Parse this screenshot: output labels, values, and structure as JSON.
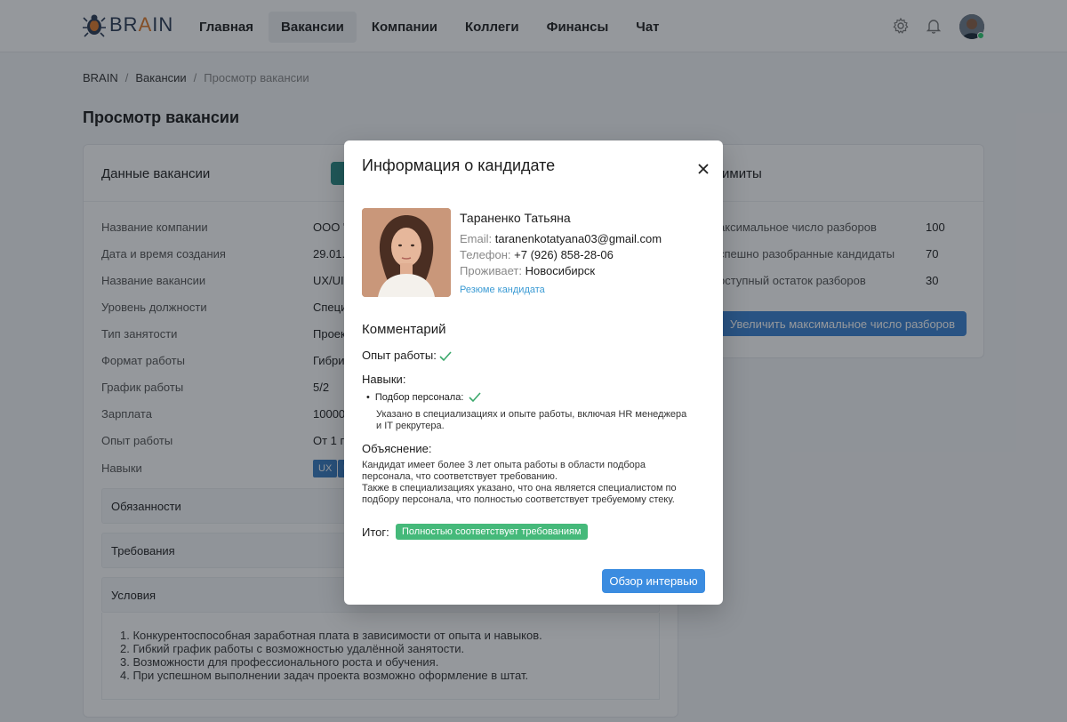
{
  "header": {
    "logo_text_pre": "BR",
    "logo_text_accent": "A",
    "logo_text_post": "IN",
    "nav": [
      {
        "label": "Главная",
        "active": false
      },
      {
        "label": "Вакансии",
        "active": true
      },
      {
        "label": "Компании",
        "active": false
      },
      {
        "label": "Коллеги",
        "active": false
      },
      {
        "label": "Финансы",
        "active": false
      },
      {
        "label": "Чат",
        "active": false
      }
    ],
    "icons": [
      "gear-icon",
      "bell-icon"
    ]
  },
  "breadcrumb": {
    "items": [
      "BRAIN",
      "Вакансии"
    ],
    "separator": "/",
    "current": "Просмотр вакансии"
  },
  "page_title": "Просмотр вакансии",
  "vacancy_card": {
    "title": "Данные вакансии",
    "fields": [
      {
        "label": "Название компании",
        "value": "ООО \""
      },
      {
        "label": "Дата и время создания",
        "value": "29.01.2"
      },
      {
        "label": "Название вакансии",
        "value": "UX/UI"
      },
      {
        "label": "Уровень должности",
        "value": "Специ"
      },
      {
        "label": "Тип занятости",
        "value": "Проек"
      },
      {
        "label": "Формат работы",
        "value": "Гибри"
      },
      {
        "label": "График работы",
        "value": "5/2"
      },
      {
        "label": "Зарплата",
        "value": "10000"
      },
      {
        "label": "Опыт работы",
        "value": "От 1 го"
      }
    ],
    "skills_label": "Навыки",
    "skills": [
      "UX",
      "U"
    ],
    "accordions": [
      "Обязанности",
      "Требования",
      "Условия"
    ],
    "conditions": [
      "1. Конкурентоспособная заработная плата в зависимости от опыта и навыков.",
      "2. Гибкий график работы с возможностью удалённой занятости.",
      "3. Возможности для профессионального роста и обучения.",
      "4. При успешном выполнении задач проекта возможно оформление в штат."
    ]
  },
  "limits_card": {
    "title": "имиты",
    "rows": [
      {
        "label": "аксимальное число разборов",
        "value": "100"
      },
      {
        "label": "спешно разобранные кандидаты",
        "value": "70"
      },
      {
        "label": "оступный остаток разборов",
        "value": "30"
      }
    ],
    "button": "Увеличить максимальное число разборов"
  },
  "modal": {
    "title": "Информация о кандидате",
    "candidate": {
      "name": "Тараненко Татьяна",
      "email_label": "Email:",
      "email": "taranenkotatyana03@gmail.com",
      "phone_label": "Телефон:",
      "phone": "+7 (926) 858-28-06",
      "city_label": "Проживает:",
      "city": "Новосибирск",
      "resume_link": "Резюме кандидата"
    },
    "comment_title": "Комментарий",
    "experience_label": "Опыт работы:",
    "skills_label": "Навыки:",
    "skill_item": "Подбор персонала:",
    "skill_note_1": "Указано в специализациях и опыте работы, включая HR менеджера",
    "skill_note_2": "и IT рекрутера.",
    "explanation_title": "Объяснение:",
    "explanation_lines": [
      "Кандидат имеет более 3 лет опыта работы в области подбора",
      "персонала, что соответствует требованию.",
      "Также в специализациях указано, что она является специалистом по",
      "подбору персонала, что полностью соответствует требуемому стеку."
    ],
    "result_label": "Итог:",
    "result_badge": "Полностью соответствует требованиям",
    "result_color": "#45b97a",
    "primary_button": "Обзор интервью",
    "icons": [
      "close-icon",
      "check-icon"
    ]
  }
}
